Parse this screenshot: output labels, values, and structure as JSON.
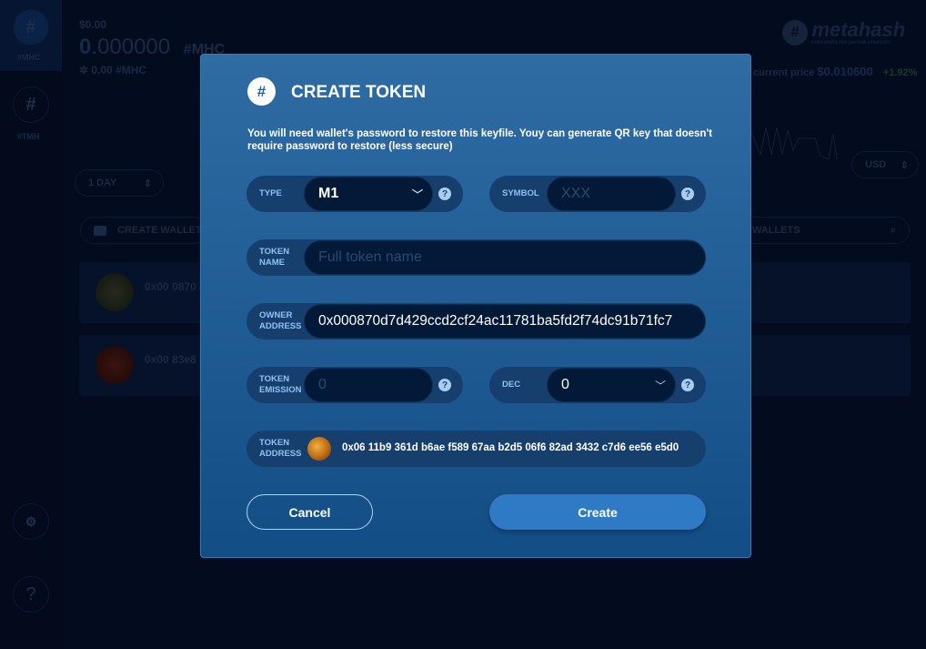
{
  "background": {
    "sidebar": [
      {
        "label": "#MHC",
        "icon": "hash-icon"
      },
      {
        "label": "#TMH",
        "icon": "hash-icon"
      }
    ],
    "balance_usd": "$0.00",
    "balance_main": "0",
    "balance_decimals": ".000000",
    "balance_currency": "#MHC",
    "balance_sub": "0.00 #MHC",
    "brand": "metahash",
    "brand_tagline": "concordia res parvae crescunt",
    "price_label": "current price",
    "price_value": "$0.010600",
    "price_change": "+1.92%",
    "period_select": "1 DAY",
    "currency_select": "USD",
    "create_wallet": "CREATE WALLET",
    "wallets_search": "WALLETS",
    "wallets": [
      {
        "address": "0x00 0870 d"
      },
      {
        "address": "0x00 83e8 3"
      }
    ]
  },
  "modal": {
    "title": "CREATE TOKEN",
    "description": "You will need wallet's password to restore this keyfile. Youy can generate QR key that doesn't require password to restore (less secure)",
    "type": {
      "label": "TYPE",
      "value": "M1"
    },
    "symbol": {
      "label": "SYMBOL",
      "placeholder": "XXX"
    },
    "token_name": {
      "label1": "TOKEN",
      "label2": "NAME",
      "placeholder": "Full token name"
    },
    "owner_address": {
      "label1": "OWNER",
      "label2": "ADDRESS",
      "value": "0x000870d7d429ccd2cf24ac11781ba5fd2f74dc91b71fc7"
    },
    "token_emission": {
      "label1": "TOKEN",
      "label2": "EMISSION",
      "placeholder": "0"
    },
    "dec": {
      "label": "DEC",
      "value": "0"
    },
    "token_address": {
      "label1": "TOKEN",
      "label2": "ADDRESS",
      "value": "0x06 11b9 361d b6ae f589 67aa b2d5 06f6 82ad 3432 c7d6 ee56 e5d0"
    },
    "cancel": "Cancel",
    "create": "Create",
    "help_glyph": "?"
  },
  "colors": {
    "accent": "#2f7ac4",
    "modal_top": "#2f6ca4",
    "modal_bottom": "#134d86",
    "positive": "#1c4a2a"
  }
}
